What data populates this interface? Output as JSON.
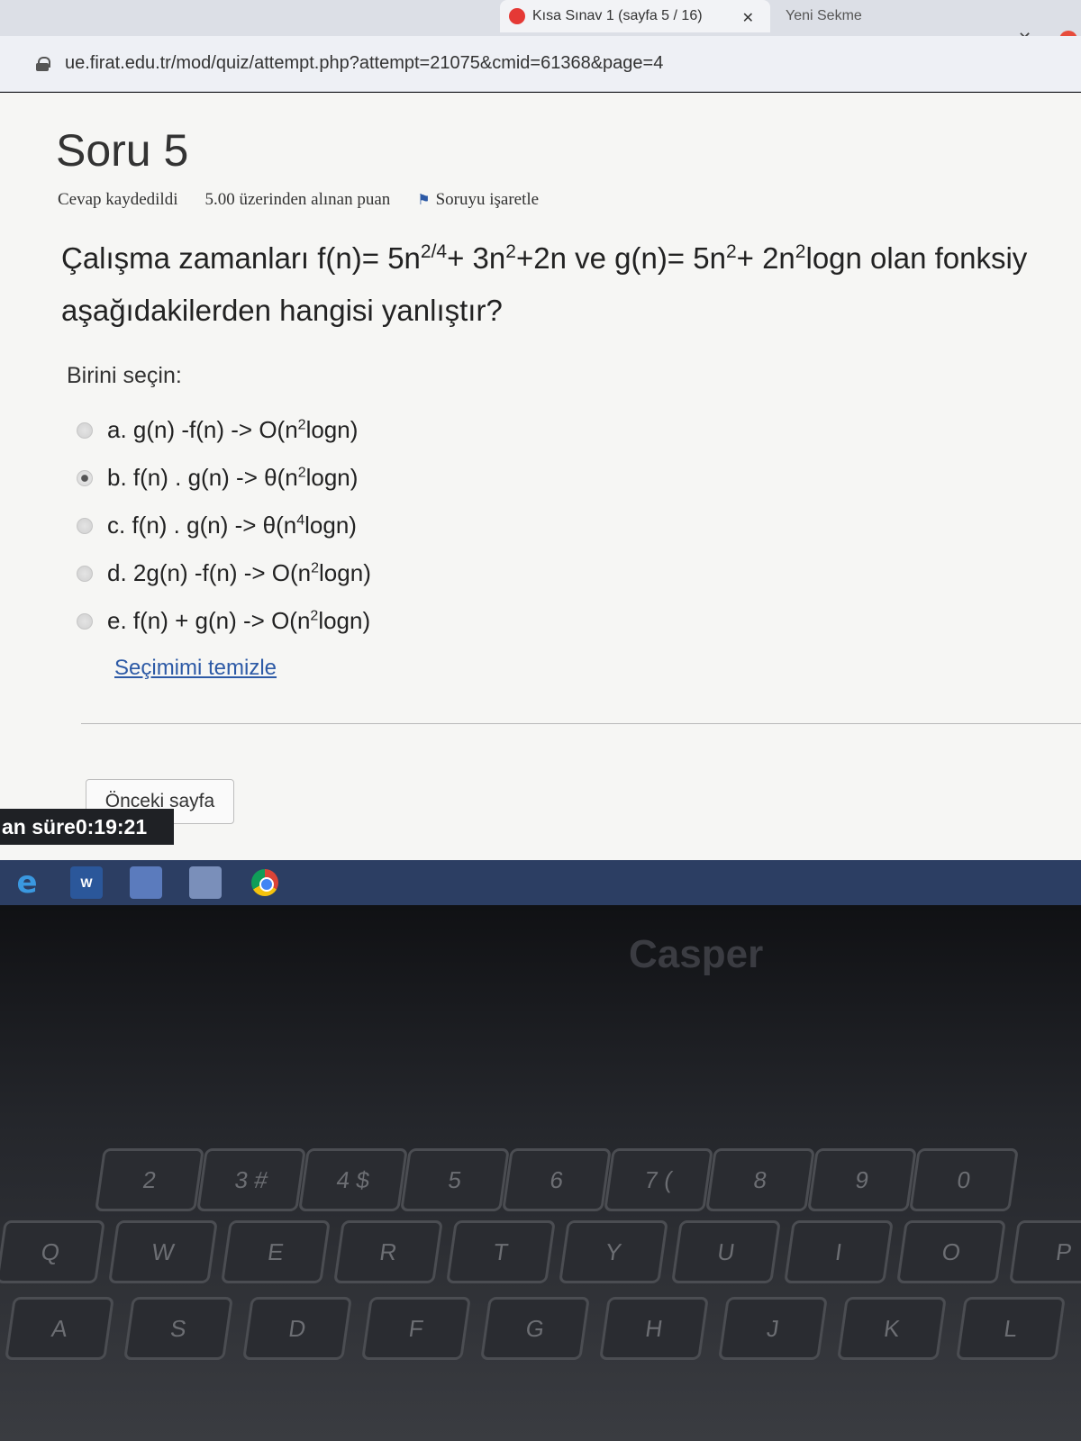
{
  "browser": {
    "active_tab_title": "Kısa Sınav 1 (sayfa 5 / 16)",
    "new_tab_title": "Yeni Sekme",
    "url": "ue.firat.edu.tr/mod/quiz/attempt.php?attempt=21075&cmid=61368&page=4"
  },
  "question": {
    "title": "Soru 5",
    "status": "Cevap kaydedildi",
    "grade": "5.00 üzerinden alınan puan",
    "flag": "Soruyu işaretle",
    "text_part1": "Çalışma zamanları f(n)= 5n",
    "exp1": "2/4",
    "text_part2": "+ 3n",
    "exp2": "2",
    "text_part3": "+2n ve g(n)= 5n",
    "exp3": "2",
    "text_part4": "+ 2n",
    "exp4": "2",
    "text_part5": "logn olan fonksiy",
    "text_line2": "aşağıdakilerden hangisi yanlıştır?",
    "choose_label": "Birini seçin:",
    "options": [
      {
        "pre": "a. g(n) -f(n)  -> O(n",
        "exp": "2",
        "post": "logn)",
        "selected": false
      },
      {
        "pre": "b. f(n) . g(n) -> θ(n",
        "exp": "2",
        "post": "logn)",
        "selected": true
      },
      {
        "pre": "c. f(n) . g(n) -> θ(n",
        "exp": "4",
        "post": "logn)",
        "selected": false
      },
      {
        "pre": "d. 2g(n) -f(n) -> O(n",
        "exp": "2",
        "post": "logn)",
        "selected": false
      },
      {
        "pre": "e. f(n) + g(n) -> O(n",
        "exp": "2",
        "post": "logn)",
        "selected": false
      }
    ],
    "clear_label": "Seçimimi temizle",
    "prev_label": "Önceki sayfa"
  },
  "timer": {
    "label": "an süre ",
    "value": "0:19:21"
  },
  "taskbar": {
    "word_label": "W"
  },
  "laptop": {
    "brand": "Casper",
    "keys_row1": [
      "2",
      "3 #",
      "4 $",
      "5",
      "6",
      "7 (",
      "8",
      "9",
      "0"
    ],
    "keys_row2": [
      "Q",
      "W",
      "E",
      "R",
      "T",
      "Y",
      "U",
      "I",
      "O",
      "P"
    ],
    "keys_row3": [
      "A",
      "S",
      "D",
      "F",
      "G",
      "H",
      "J",
      "K",
      "L"
    ]
  }
}
